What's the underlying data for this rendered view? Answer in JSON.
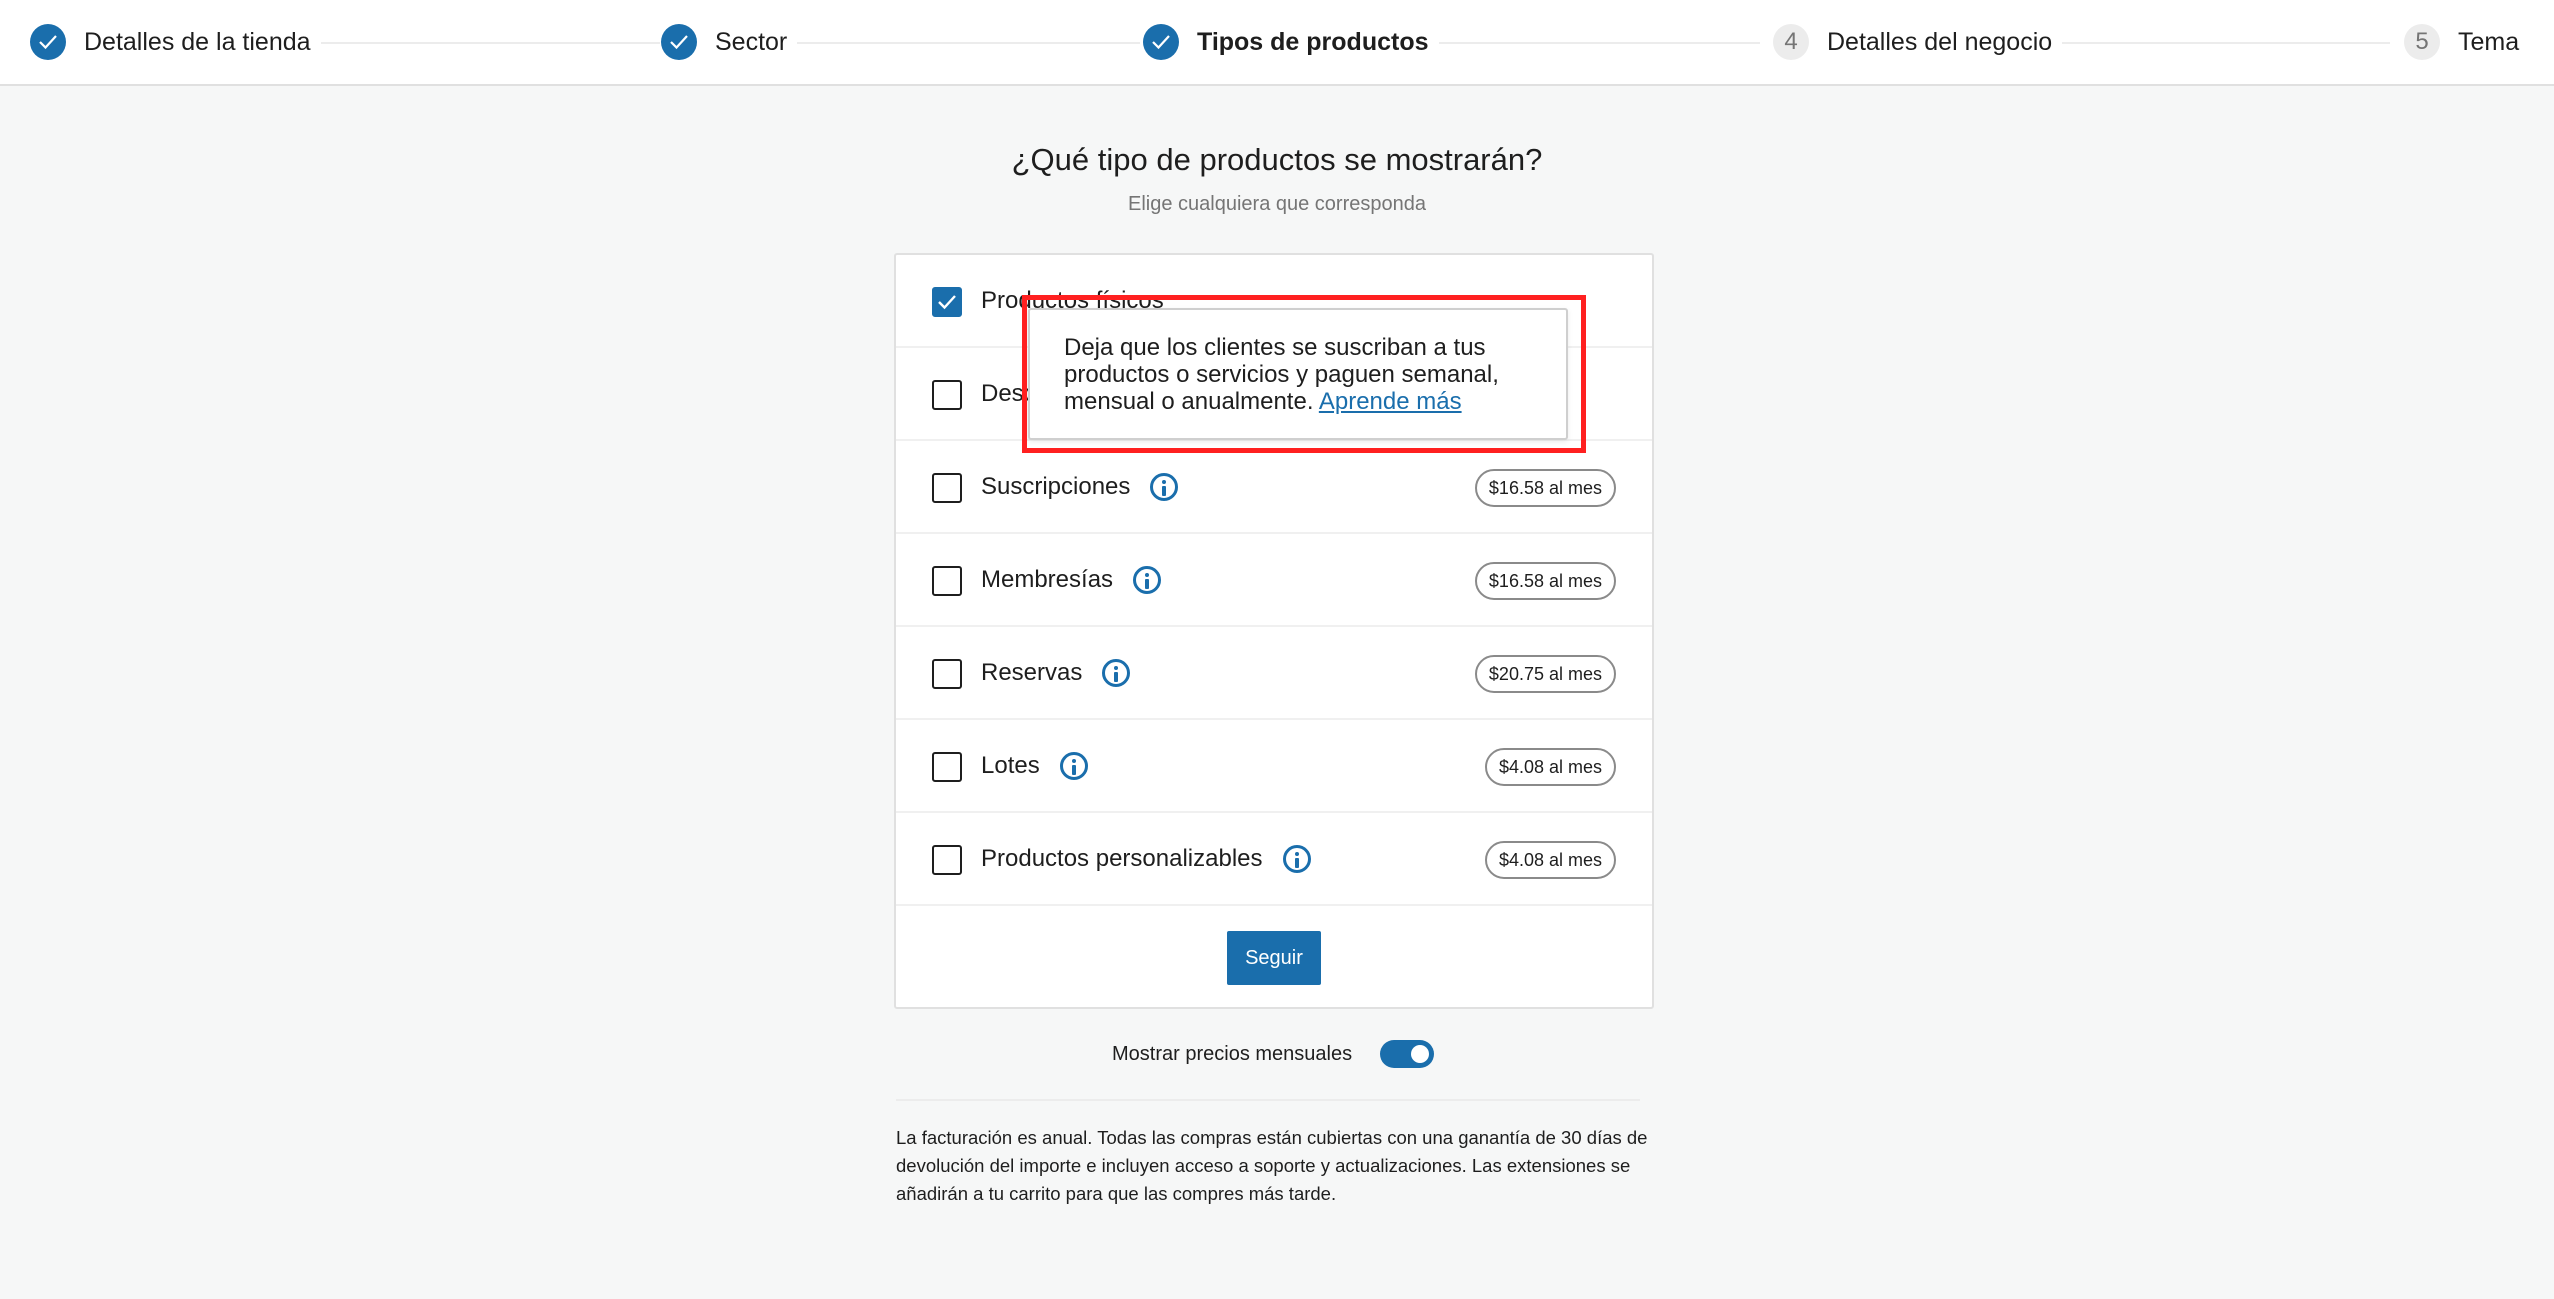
{
  "stepper": {
    "steps": [
      {
        "label": "Detalles de la tienda",
        "status": "done",
        "icon": "check-icon"
      },
      {
        "label": "Sector",
        "status": "done",
        "icon": "check-icon"
      },
      {
        "label": "Tipos de productos",
        "status": "active-done",
        "icon": "check-icon"
      },
      {
        "label": "Detalles del negocio",
        "status": "todo",
        "number": "4"
      },
      {
        "label": "Tema",
        "status": "todo",
        "number": "5"
      }
    ]
  },
  "page": {
    "title": "¿Qué tipo de productos se mostrarán?",
    "subtitle": "Elige cualquiera que corresponda"
  },
  "products": [
    {
      "label": "Productos físicos",
      "checked": true,
      "has_info": false,
      "price": null
    },
    {
      "label": "Descargables",
      "visible_text": "Des",
      "checked": false,
      "has_info": false,
      "price": null
    },
    {
      "label": "Suscripciones",
      "checked": false,
      "has_info": true,
      "price": "$16.58 al mes"
    },
    {
      "label": "Membresías",
      "checked": false,
      "has_info": true,
      "price": "$16.58 al mes"
    },
    {
      "label": "Reservas",
      "checked": false,
      "has_info": true,
      "price": "$20.75 al mes"
    },
    {
      "label": "Lotes",
      "checked": false,
      "has_info": true,
      "price": "$4.08 al mes"
    },
    {
      "label": "Productos personalizables",
      "checked": false,
      "has_info": true,
      "price": "$4.08 al mes"
    }
  ],
  "continue_button": "Seguir",
  "tooltip": {
    "text": "Deja que los clientes se suscriban a tus productos o servicios y paguen semanal, mensual o anualmente. ",
    "link": "Aprende más"
  },
  "toggle": {
    "label": "Mostrar precios mensuales",
    "on": true
  },
  "footer": "La facturación es anual. Todas las compras están cubiertas con una ganantía de 30 días de devolución del importe e incluyen acceso a soporte y actualizaciones. Las extensiones se añadirán a tu carrito para que las compres más tarde.",
  "colors": {
    "accent": "#1a6eac",
    "highlight": "#ff2020",
    "background": "#f6f7f7"
  }
}
